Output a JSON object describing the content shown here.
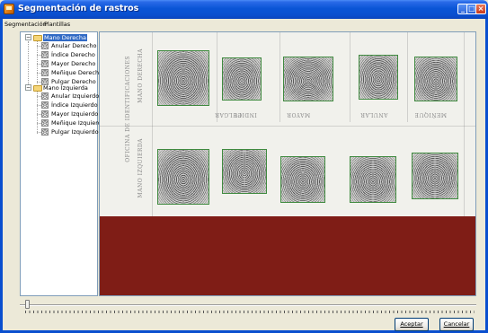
{
  "window": {
    "title": "Segmentación de rastros"
  },
  "menu": [
    {
      "label": "Segmentación"
    },
    {
      "label": "Plantillas"
    }
  ],
  "tree": {
    "right_hand": {
      "label": "Mano Derecha",
      "children": [
        "Anular Derecho",
        "Índice Derecho",
        "Mayor Derecho",
        "Meñique Derecho",
        "Pulgar Derecho"
      ]
    },
    "left_hand": {
      "label": "Mano Izquierda",
      "children": [
        "Anular Izquierdo",
        "Índice Izquierdo",
        "Mayor Izquierdo",
        "Meñique Izquierdo",
        "Pulgar Izquierdo"
      ]
    }
  },
  "document": {
    "side_top": "MANO DERECHA",
    "side_bottom": "MANO IZQUIERDA",
    "office": "OFICINA DE IDENTIFICACIONES",
    "columns_top": [
      "PULGAR",
      "INDICE",
      "MAYOR",
      "ANULAR",
      "MEÑIQUE"
    ]
  },
  "buttons": {
    "accept": "Aceptar",
    "cancel": "Cancelar"
  },
  "colors": {
    "viewport_bg": "#7f1d16",
    "selection": "#316ac5",
    "titlebar": "#0a55d6"
  }
}
